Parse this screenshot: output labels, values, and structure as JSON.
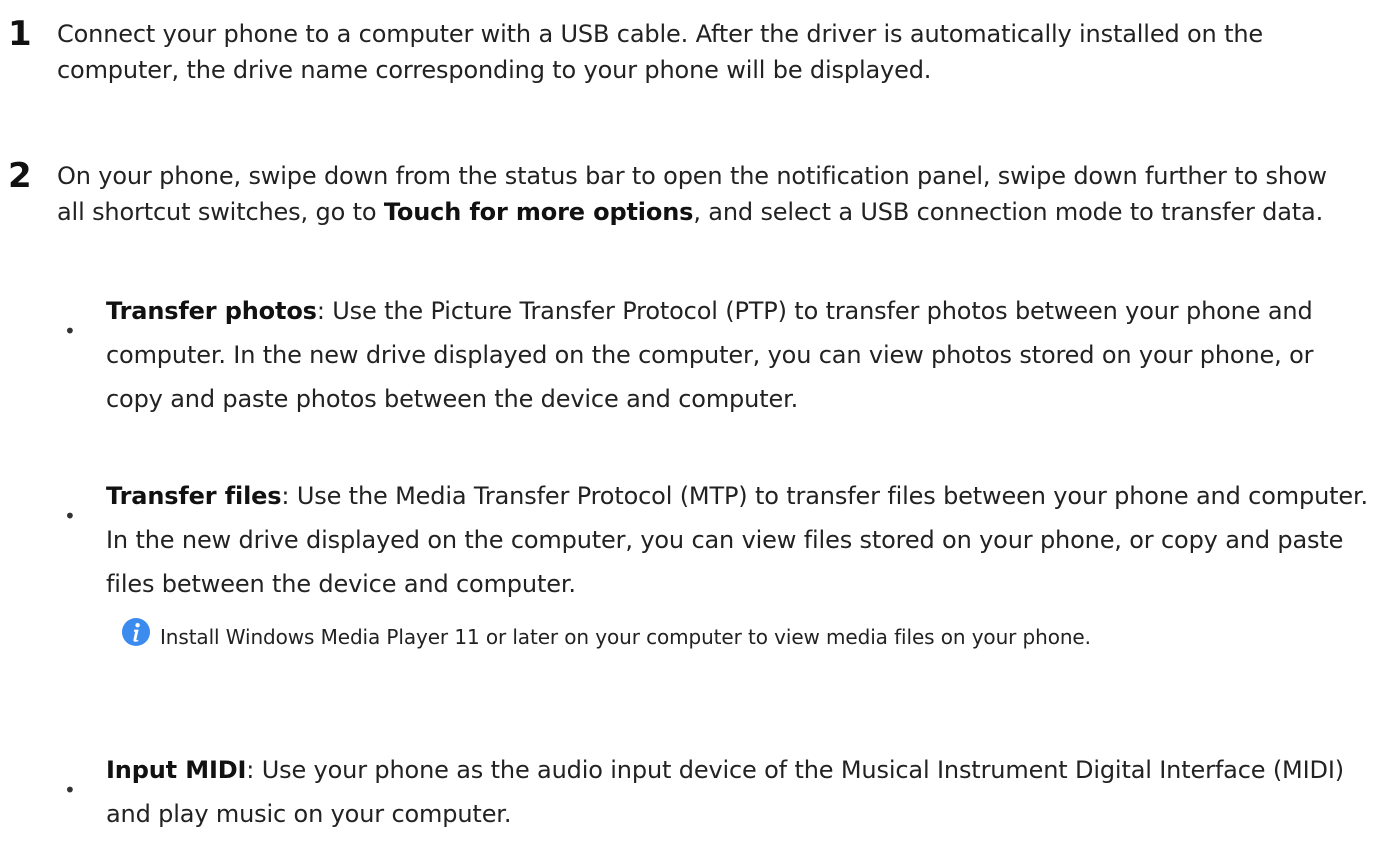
{
  "steps": [
    {
      "number": "1",
      "text": "Connect your phone to a computer with a USB cable. After the driver is automatically installed on the computer, the drive name corresponding to your phone will be displayed."
    },
    {
      "number": "2",
      "text_before": "On your phone, swipe down from the status bar to open the notification panel, swipe down further to show all shortcut switches, go to ",
      "bold": "Touch for more options",
      "text_after": ", and select a USB connection mode to transfer data."
    }
  ],
  "bullets": [
    {
      "marker": "•",
      "title": "Transfer photos",
      "text": ": Use the Picture Transfer Protocol (PTP) to transfer photos between your phone and computer. In the new drive displayed on the computer, you can view photos stored on your phone, or copy and paste photos between the device and computer."
    },
    {
      "marker": "•",
      "title": "Transfer files",
      "text": ": Use the Media Transfer Protocol (MTP) to transfer files between your phone and computer. In the new drive displayed on the computer, you can view files stored on your phone, or copy and paste files between the device and computer."
    },
    {
      "marker": "•",
      "title": "Input MIDI",
      "text": ": Use your phone as the audio input device of the Musical Instrument Digital Interface (MIDI) and play music on your computer."
    }
  ],
  "note": {
    "icon": "info-icon",
    "icon_color": "#3c8cf0",
    "text": "Install Windows Media Player 11 or later on your computer to view media files on your phone."
  }
}
